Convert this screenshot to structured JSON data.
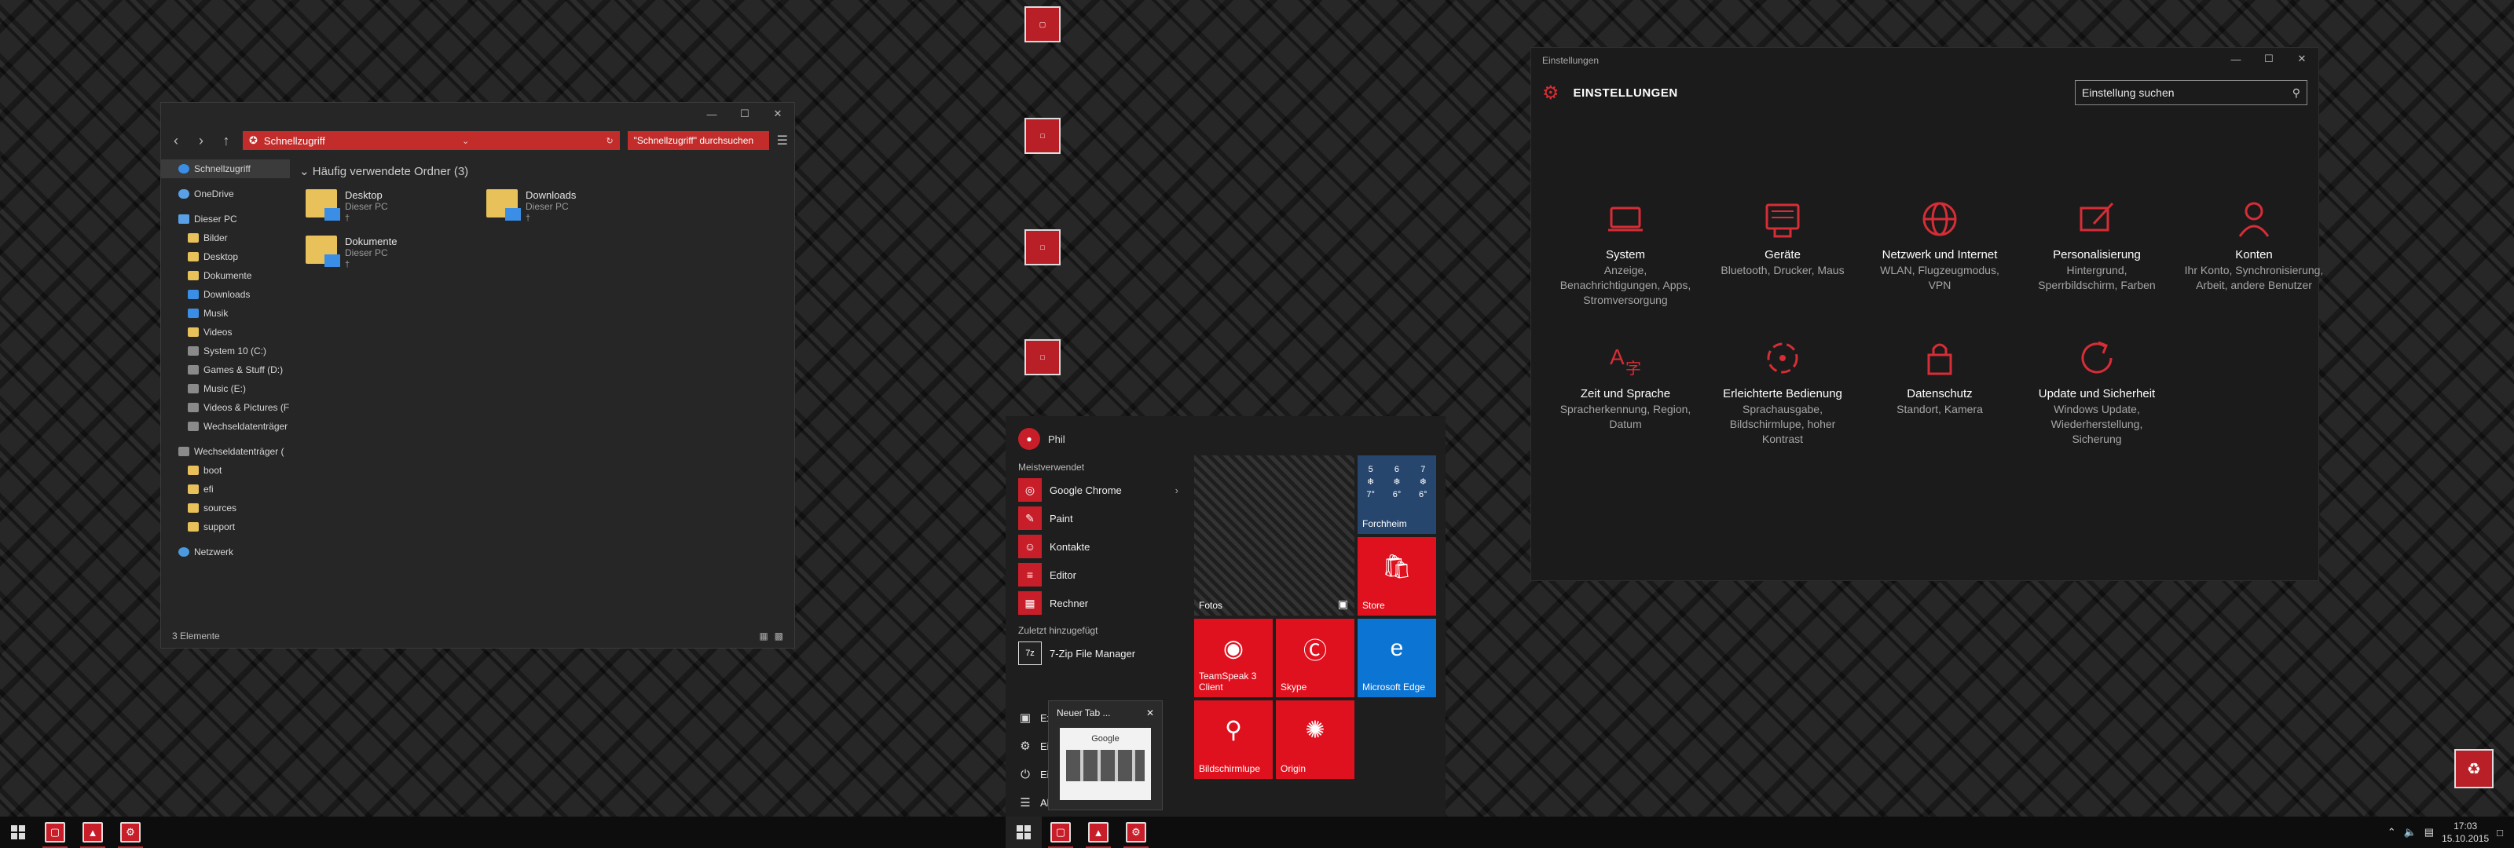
{
  "explorer": {
    "address": "Schnellzugriff",
    "search_placeholder": "\"Schnellzugriff\" durchsuchen",
    "group_header": "Häufig verwendete Ordner (3)",
    "status": "3 Elemente",
    "nav": [
      {
        "label": "Schnellzugriff",
        "icon": "star-icon"
      },
      {
        "label": "OneDrive",
        "icon": "cloud-icon"
      },
      {
        "label": "Dieser PC",
        "icon": "computer-icon"
      },
      {
        "label": "Bilder",
        "icon": "folder-icon"
      },
      {
        "label": "Desktop",
        "icon": "folder-icon"
      },
      {
        "label": "Dokumente",
        "icon": "folder-icon"
      },
      {
        "label": "Downloads",
        "icon": "download-icon"
      },
      {
        "label": "Musik",
        "icon": "music-icon"
      },
      {
        "label": "Videos",
        "icon": "folder-icon"
      },
      {
        "label": "System 10 (C:)",
        "icon": "drive-icon"
      },
      {
        "label": "Games & Stuff (D:)",
        "icon": "drive-icon"
      },
      {
        "label": "Music (E:)",
        "icon": "drive-icon"
      },
      {
        "label": "Videos & Pictures (F",
        "icon": "drive-icon"
      },
      {
        "label": "Wechseldatenträger",
        "icon": "usb-drive-icon"
      },
      {
        "label": "Wechseldatenträger (",
        "icon": "usb-drive-icon"
      },
      {
        "label": "boot",
        "icon": "folder-icon"
      },
      {
        "label": "efi",
        "icon": "folder-icon"
      },
      {
        "label": "sources",
        "icon": "folder-icon"
      },
      {
        "label": "support",
        "icon": "folder-icon"
      },
      {
        "label": "Netzwerk",
        "icon": "network-icon"
      }
    ],
    "folders": [
      {
        "name": "Desktop",
        "location": "Dieser PC"
      },
      {
        "name": "Downloads",
        "location": "Dieser PC"
      },
      {
        "name": "Dokumente",
        "location": "Dieser PC"
      }
    ]
  },
  "start": {
    "user": "Phil",
    "most_used_label": "Meistverwendet",
    "recent_label": "Zuletzt hinzugefügt",
    "most_used": [
      "Google Chrome",
      "Paint",
      "Kontakte",
      "Editor",
      "Rechner"
    ],
    "recent": [
      "7-Zip File Manager"
    ],
    "bottom": [
      "Ex",
      "Ein",
      "Ein",
      "All"
    ],
    "tiles": {
      "weather_days": [
        "5",
        "6",
        "7"
      ],
      "weather_temps": [
        "7°",
        "6°",
        "6°"
      ],
      "weather_city": "Forchheim",
      "fotos": "Fotos",
      "store": "Store",
      "teamspeak": "TeamSpeak 3 Client",
      "skype": "Skype",
      "edge": "Microsoft Edge",
      "magnifier": "Bildschirmlupe",
      "origin": "Origin"
    },
    "thumb_title": "Neuer Tab ...",
    "thumb_page": "Google"
  },
  "settings": {
    "window_title": "Einstellungen",
    "header": "EINSTELLUNGEN",
    "search_placeholder": "Einstellung suchen",
    "items": [
      {
        "name": "System",
        "desc": "Anzeige, Benachrichtigungen, Apps, Stromversorgung"
      },
      {
        "name": "Geräte",
        "desc": "Bluetooth, Drucker, Maus"
      },
      {
        "name": "Netzwerk und Internet",
        "desc": "WLAN, Flugzeugmodus, VPN"
      },
      {
        "name": "Personalisierung",
        "desc": "Hintergrund, Sperrbildschirm, Farben"
      },
      {
        "name": "Konten",
        "desc": "Ihr Konto, Synchronisierung, Arbeit, andere Benutzer"
      },
      {
        "name": "Zeit und Sprache",
        "desc": "Spracherkennung, Region, Datum"
      },
      {
        "name": "Erleichterte Bedienung",
        "desc": "Sprachausgabe, Bildschirmlupe, hoher Kontrast"
      },
      {
        "name": "Datenschutz",
        "desc": "Standort, Kamera"
      },
      {
        "name": "Update und Sicherheit",
        "desc": "Windows Update, Wiederherstellung, Sicherung"
      }
    ]
  },
  "taskbar": {
    "time": "17:03",
    "date": "15.10.2015"
  },
  "colors": {
    "accent": "#d0202b",
    "background": "#1c1c1c"
  }
}
